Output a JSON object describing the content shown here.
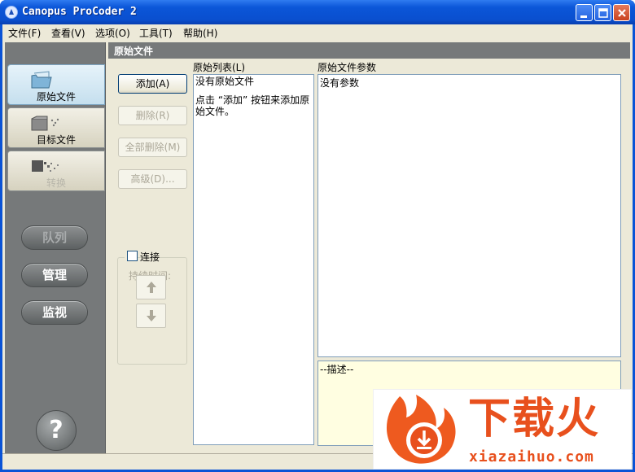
{
  "window": {
    "title": "Canopus ProCoder 2"
  },
  "menu": [
    {
      "label": "文件(F)"
    },
    {
      "label": "查看(V)"
    },
    {
      "label": "选项(O)"
    },
    {
      "label": "工具(T)"
    },
    {
      "label": "帮助(H)"
    }
  ],
  "nav": {
    "tabs": [
      {
        "label": "原始文件",
        "icon": "folder-open-icon"
      },
      {
        "label": "目标文件",
        "icon": "folder-target-icon"
      },
      {
        "label": "转换",
        "icon": "convert-icon"
      }
    ],
    "pills": [
      {
        "label": "队列"
      },
      {
        "label": "管理"
      },
      {
        "label": "监视"
      }
    ],
    "help": "?"
  },
  "header": {
    "title": "原始文件"
  },
  "buttons": {
    "add": "添加(A)",
    "delete": "删除(R)",
    "delete_all": "全部删除(M)",
    "advanced": "高级(D)..."
  },
  "concat": {
    "label": "连接",
    "duration": "持续时间:"
  },
  "source_list": {
    "label": "原始列表(L)",
    "line1": "没有原始文件",
    "line2": "点击 “添加” 按钮来添加原",
    "line3": "始文件。"
  },
  "params": {
    "label": "原始文件参数",
    "text": "没有参数"
  },
  "description": {
    "text": "--描述--"
  },
  "watermark": {
    "main": "下载火",
    "domain": "xiazaihuo.com"
  },
  "colors": {
    "brand_orange": "#e8501d",
    "title_blue": "#0a53d6",
    "panel_gray": "#76797a"
  }
}
